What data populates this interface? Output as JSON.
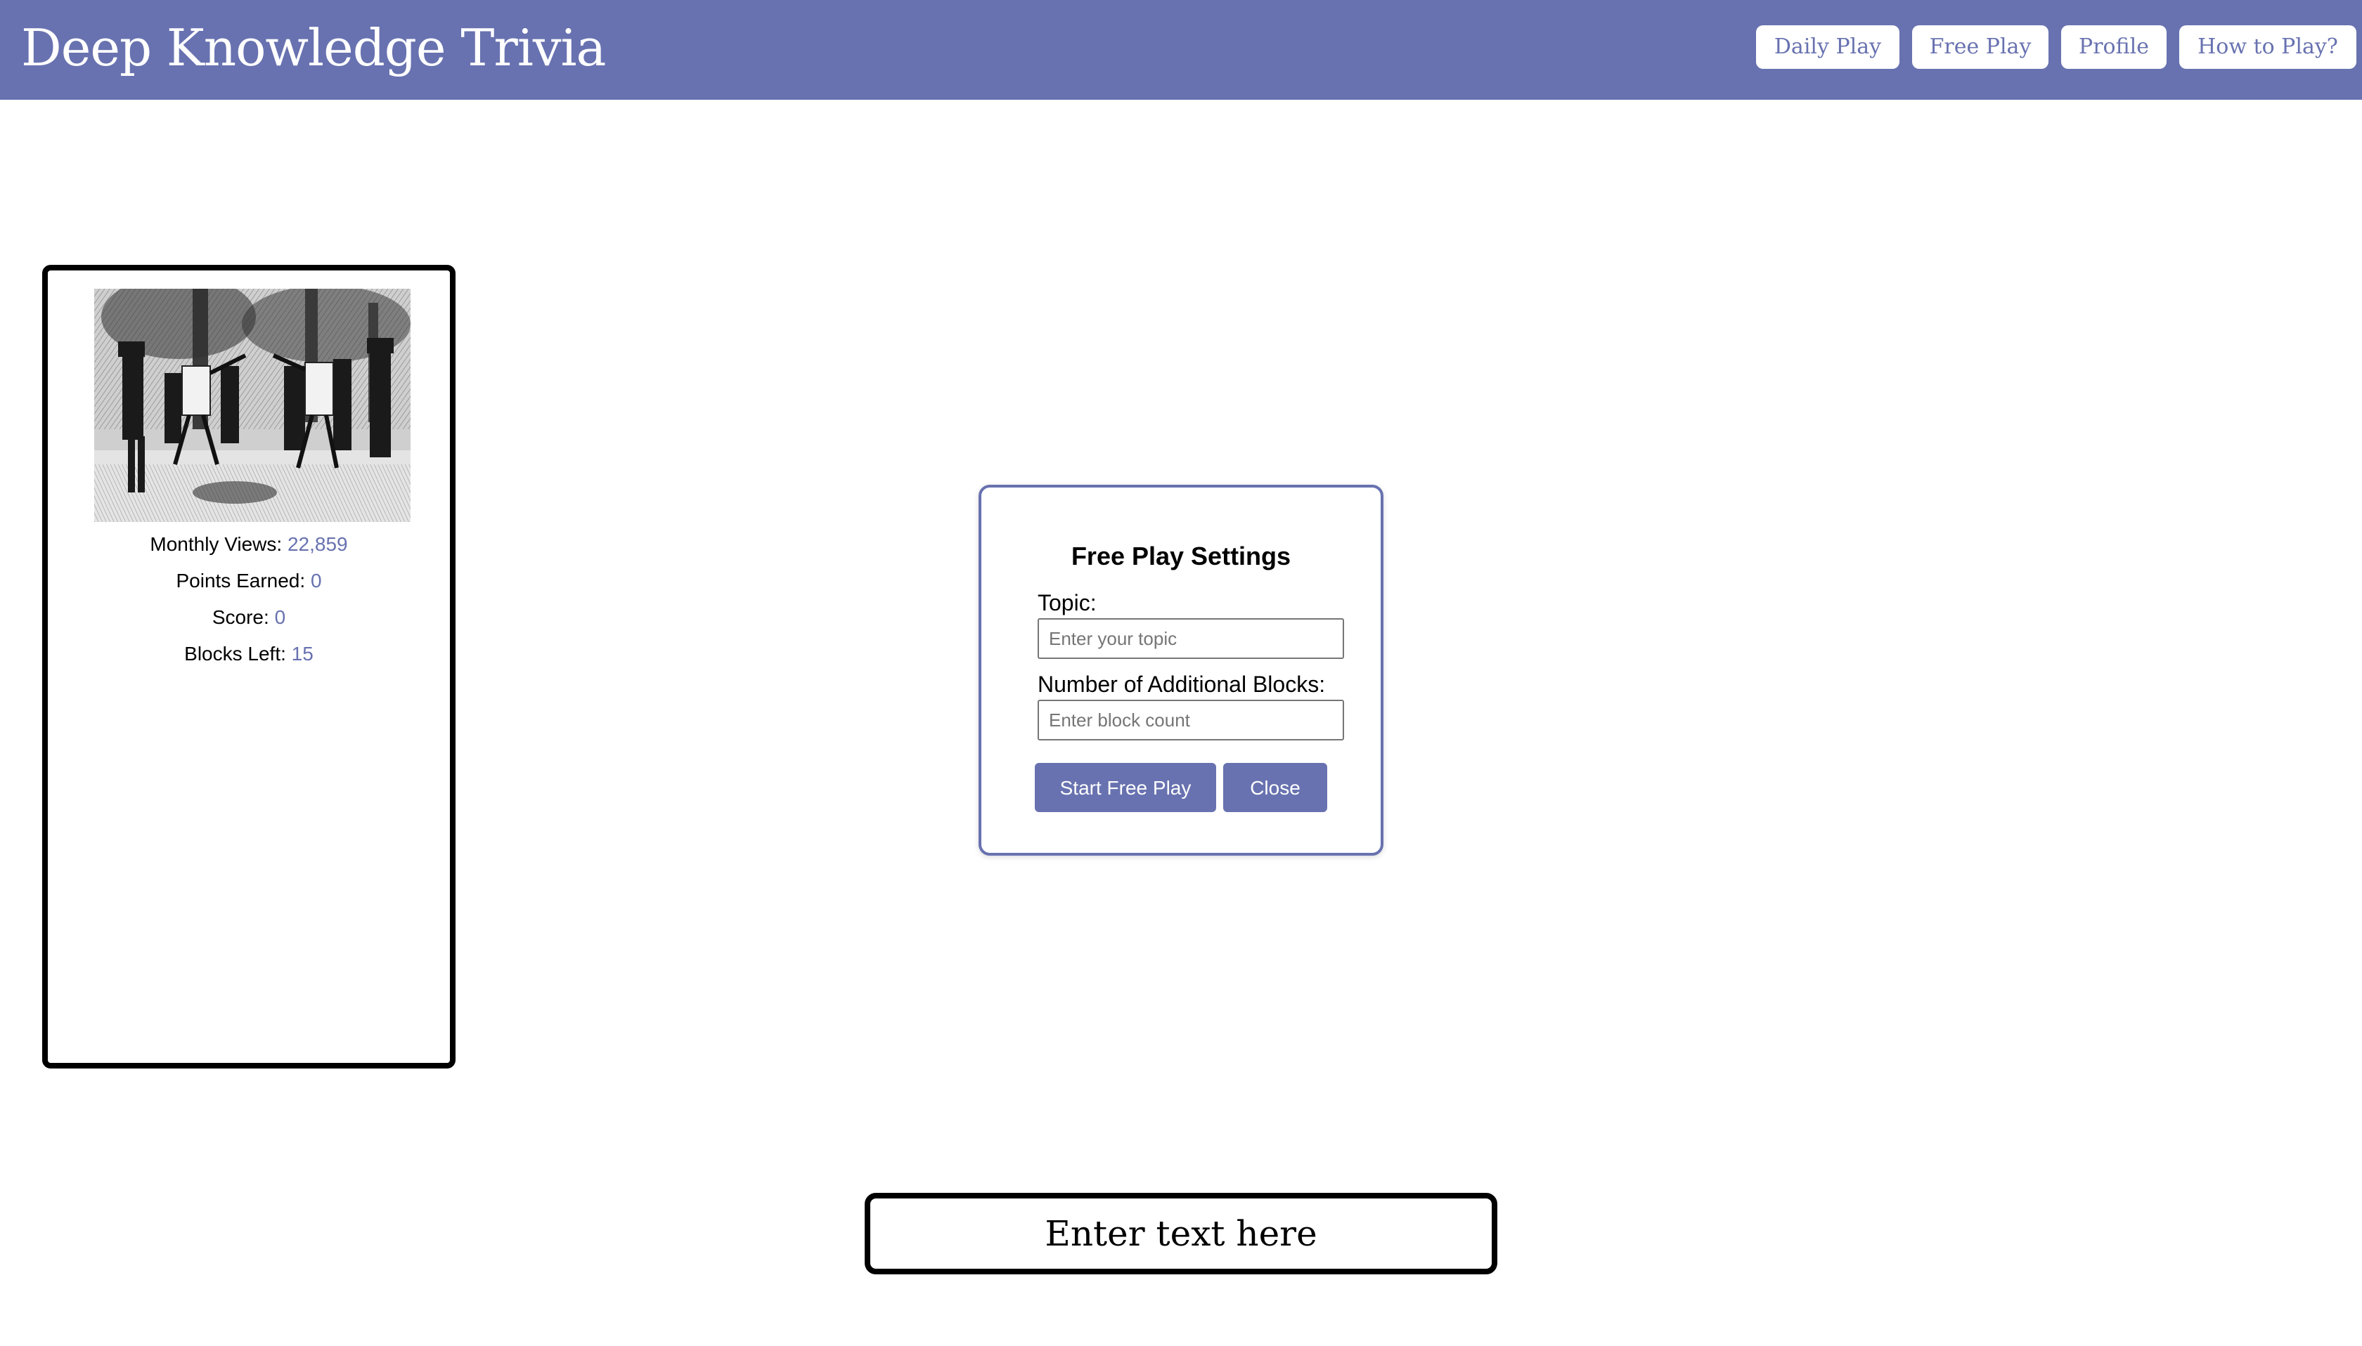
{
  "header": {
    "title": "Deep Knowledge Trivia",
    "nav": [
      {
        "label": "Daily Play"
      },
      {
        "label": "Free Play"
      },
      {
        "label": "Profile"
      },
      {
        "label": "How to Play?"
      }
    ]
  },
  "stats": {
    "image_alt": "engraving of a duel scene",
    "monthly_views_label": "Monthly Views: ",
    "monthly_views_value": "22,859",
    "points_label": "Points Earned: ",
    "points_value": "0",
    "score_label": "Score: ",
    "score_value": "0",
    "blocks_label": "Blocks Left: ",
    "blocks_value": "15"
  },
  "modal": {
    "title": "Free Play Settings",
    "topic_label": "Topic:",
    "topic_placeholder": "Enter your topic",
    "topic_value": "",
    "blocks_label": "Number of Additional Blocks:",
    "blocks_placeholder": "Enter block count",
    "blocks_value": "",
    "start_label": "Start Free Play",
    "close_label": "Close"
  },
  "text_box": {
    "label": "Enter text here"
  },
  "colors": {
    "accent": "#6872b0",
    "background": "#ffffff",
    "text": "#000000"
  }
}
